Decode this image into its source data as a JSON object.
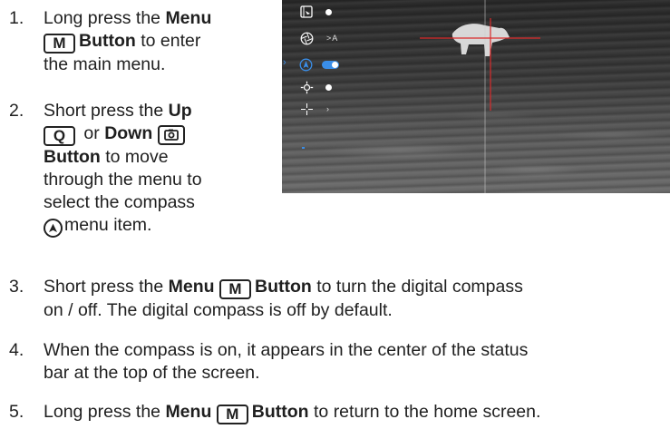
{
  "steps": [
    {
      "num": "1.",
      "l1a": "Long press the ",
      "l1b": "Menu",
      "key": "M",
      "l2": "Button",
      "l2b": " to enter",
      "l3": "the main menu."
    },
    {
      "num": "2.",
      "l1a": "Short press the ",
      "l1b": "Up",
      "key_up": "Q",
      "or": " or ",
      "down": "Down",
      "key_down": "camera-key-icon",
      "b1": "Button",
      "b2": " to move",
      "l5": "through the menu to",
      "l6": "select the compass",
      "l7": "menu item."
    },
    {
      "num": "3.",
      "a": "Short press the ",
      "b": "Menu",
      "key": "M",
      "c": "Button",
      "d": " to turn the digital compass",
      "e": "on / off. The digital compass is off by default."
    },
    {
      "num": "4.",
      "a": "When the compass is on, it appears in the center of the status",
      "b": "bar at the top of the screen."
    },
    {
      "num": "5.",
      "a": "Long press the ",
      "b": "Menu",
      "key": "M",
      "c": "Button",
      "d": " to return to the home screen."
    }
  ],
  "screen": {
    "menu": [
      {
        "icon": "picture-in-picture-icon",
        "state": "dot"
      },
      {
        "icon": "aperture-icon",
        "state": "A"
      },
      {
        "icon": "compass-icon",
        "state": "toggle-on"
      },
      {
        "icon": "brightness-icon",
        "state": "dot"
      },
      {
        "icon": "reticle-icon",
        "state": "arrow"
      }
    ],
    "menu_arrow_label": ">A",
    "colors": {
      "accent": "#3a8ee8",
      "reticle": "#d92a2a"
    }
  }
}
